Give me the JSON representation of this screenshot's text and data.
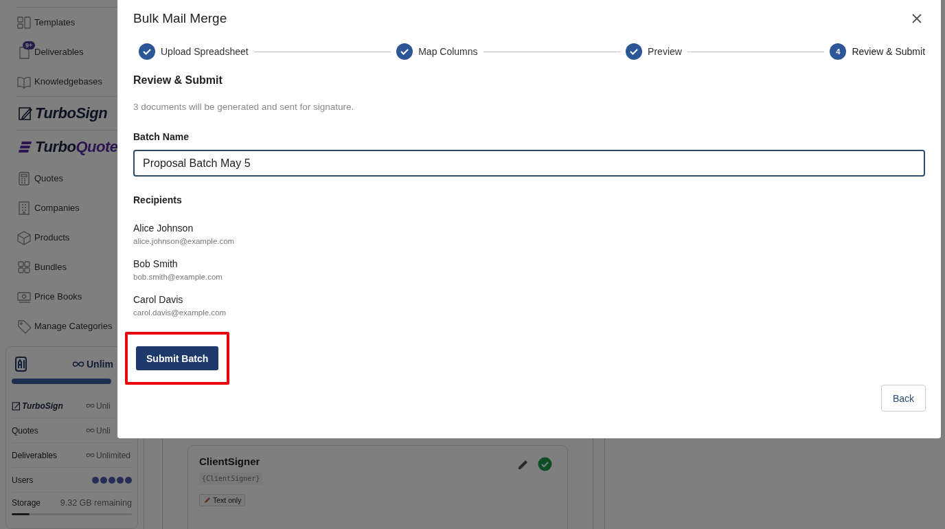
{
  "sidebar": {
    "items": [
      {
        "label": "Templates"
      },
      {
        "label": "Deliverables",
        "badge": "9+"
      },
      {
        "label": "Knowledgebases"
      }
    ],
    "brands": [
      {
        "name": "TurboSign"
      },
      {
        "name": "Turbo",
        "accent": "Quote"
      }
    ],
    "quote_items": [
      {
        "label": "Quotes"
      },
      {
        "label": "Companies"
      },
      {
        "label": "Products"
      },
      {
        "label": "Bundles"
      },
      {
        "label": "Price Books"
      },
      {
        "label": "Manage Categories"
      }
    ],
    "usage": {
      "ai_value": "Unlim",
      "rows": [
        {
          "kind": "unlimited",
          "label": "TurboSign",
          "logo": true,
          "value": "Unli"
        },
        {
          "kind": "unlimited",
          "label": "Quotes",
          "value": "Unli"
        },
        {
          "kind": "unlimited",
          "label": "Deliverables",
          "value": "Unlimited"
        },
        {
          "kind": "dots",
          "label": "Users"
        },
        {
          "kind": "storage",
          "label": "Storage",
          "value": "9.32 GB remaining",
          "level": 0.15
        }
      ]
    }
  },
  "background_card": {
    "title": "ClientSigner",
    "token": "{ClientSigner}",
    "chip": "Text only",
    "verified": true
  },
  "dialog": {
    "title": "Bulk Mail Merge",
    "steps": [
      {
        "label": "Upload Spreadsheet",
        "completed": true,
        "selected": false
      },
      {
        "label": "Map Columns",
        "completed": true,
        "selected": false
      },
      {
        "label": "Preview",
        "completed": true,
        "selected": false
      },
      {
        "label": "Review & Submit",
        "number": "4",
        "completed": false,
        "selected": true
      }
    ],
    "heading": "Review & Submit",
    "description": "3 documents will be generated and sent for signature.",
    "batch_label": "Batch Name",
    "batch_value": "Proposal Batch May 5",
    "recipients_label": "Recipients",
    "recipients": [
      {
        "name": "Alice Johnson",
        "email": "alice.johnson@example.com"
      },
      {
        "name": "Bob Smith",
        "email": "bob.smith@example.com"
      },
      {
        "name": "Carol Davis",
        "email": "carol.davis@example.com"
      }
    ],
    "submit": {
      "label": "Submit Batch",
      "highlighted": true
    },
    "back": "Back"
  }
}
